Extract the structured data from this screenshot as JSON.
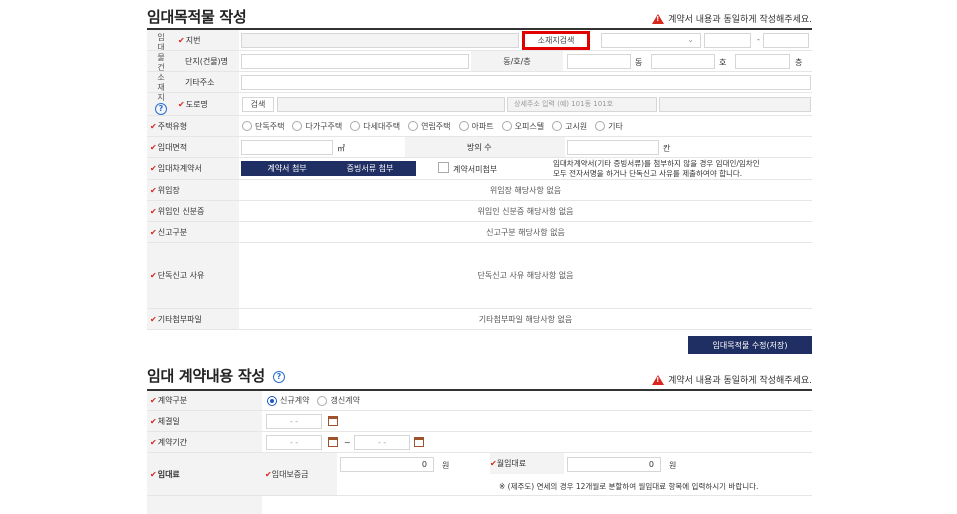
{
  "section1": {
    "title": "임대목적물 작성",
    "warning": "계약서 내용과 동일하게 작성해주세요.",
    "side_label_chars": [
      "임",
      "대",
      "물",
      "건",
      "소",
      "재",
      "지"
    ],
    "jibun_label": "지번",
    "location_search_button": "소재지검색",
    "danji_label": "단지(건물)명",
    "dong_ho_label": "동/호/층",
    "dong_unit": "동",
    "ho_unit": "호",
    "floor_unit": "층",
    "etc_address_label": "기타주소",
    "road_label": "도로명",
    "road_search_button": "검색",
    "detail_placeholder": "상세주소 입력 (예) 101동 101호",
    "house_type_label": "주택유형",
    "house_types": [
      "단독주택",
      "다가구주택",
      "다세대주택",
      "연립주택",
      "아파트",
      "오피스텔",
      "고시원",
      "기타"
    ],
    "area_label": "임대면적",
    "area_unit": "㎡",
    "rooms_label": "방의 수",
    "rooms_unit": "칸",
    "contract_label": "임대차계약서",
    "attach_contract_button": "계약서 첨부",
    "attach_proof_button": "증빙서류 첨부",
    "no_contract_label": "계약서미첨부",
    "contract_notice_1": "임대차계약서(기타 증빙서류)를 첨부하지 않을 경우 임대인/임차인",
    "contract_notice_2": "모두 전자서명을 하거나 단독신고 사유를 제출하여야 합니다.",
    "delegate_label": "위임장",
    "delegate_value": "위임장 해당사항 없음",
    "delegate_id_label": "위임인 신분증",
    "delegate_id_value": "위임인 신분증 해당사항 없음",
    "report_type_label": "신고구분",
    "report_type_value": "신고구분 해당사항 없음",
    "solo_reason_label": "단독신고 사유",
    "solo_reason_value": "단독신고 사유 해당사항 없음",
    "etc_file_label": "기타첨부파일",
    "etc_file_value": "기타첨부파일 해당사항 없음",
    "save_button": "임대목적물 수정(저장)",
    "jibun_dash": "-"
  },
  "section2": {
    "title": "임대 계약내용 작성",
    "warning": "계약서 내용과 동일하게 작성해주세요.",
    "contract_type_label": "계약구분",
    "contract_types": [
      "신규계약",
      "갱신계약"
    ],
    "contract_type_selected": "신규계약",
    "sign_date_label": "체결일",
    "period_label": "계약기간",
    "date_placeholder": "-  -",
    "tilde": "~",
    "rent_label": "임대료",
    "deposit_label": "임대보증금",
    "deposit_value": "0",
    "won": "원",
    "monthly_label": "월임대료",
    "monthly_value": "0",
    "rent_notice": "※ (제주도) 연세의 경우 12개월로 분할하여 월임대료 항목에 입력하시기 바랍니다."
  },
  "colors": {
    "required_mark": "#d9271e",
    "navy_button": "#1f2f63",
    "highlight_border": "#e00000",
    "radio_selected": "#1a56c7"
  }
}
